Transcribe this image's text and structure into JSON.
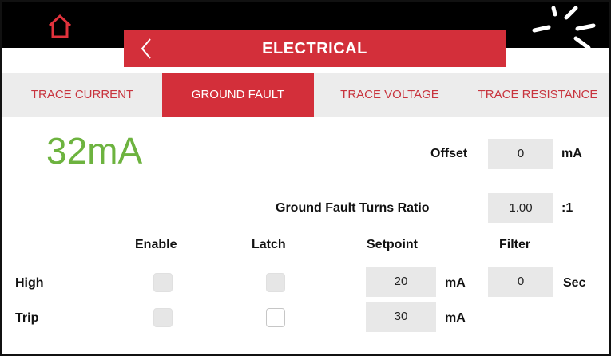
{
  "header": {
    "title": "ELECTRICAL",
    "home_icon": "home-icon",
    "back_icon": "chevron-left-icon",
    "spinner_icon": "loading-spinner-icon",
    "accent_color": "#d32f3a"
  },
  "tabs": [
    {
      "label": "TRACE CURRENT",
      "active": false
    },
    {
      "label": "GROUND FAULT",
      "active": true
    },
    {
      "label": "TRACE VOLTAGE",
      "active": false
    },
    {
      "label": "TRACE RESISTANCE",
      "active": false
    }
  ],
  "reading": {
    "value": "32mA",
    "color": "#6db33f"
  },
  "offset": {
    "label": "Offset",
    "value": "0",
    "unit": "mA"
  },
  "turns_ratio": {
    "label": "Ground Fault Turns Ratio",
    "value": "1.00",
    "unit": ":1"
  },
  "columns": {
    "enable": "Enable",
    "latch": "Latch",
    "setpoint": "Setpoint",
    "filter": "Filter"
  },
  "rows": [
    {
      "label": "High",
      "enable": false,
      "latch": false,
      "setpoint": "20",
      "setpoint_unit": "mA",
      "filter": "0",
      "filter_unit": "Sec"
    },
    {
      "label": "Trip",
      "enable": false,
      "latch": false,
      "setpoint": "30",
      "setpoint_unit": "mA"
    }
  ]
}
